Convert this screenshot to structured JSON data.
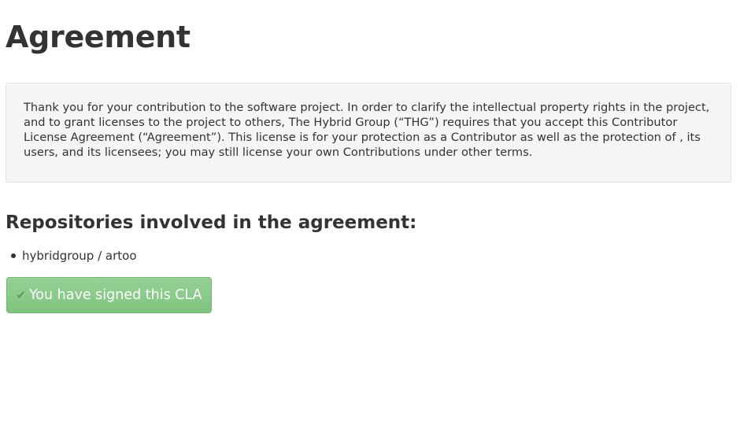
{
  "header": {
    "title": "Agreement"
  },
  "agreement": {
    "text": "Thank you for your contribution to the software project. In order to clarify the intellectual property rights in the project, and to grant licenses to the project to others, The Hybrid Group (“THG”) requires that you accept this Contributor License Agreement (“Agreement”). This license is for your protection as a Contributor as well as the protection of , its users, and its licensees; you may still license your own Contributions under other terms."
  },
  "repositories": {
    "heading": "Repositories involved in the agreement:",
    "items": [
      {
        "label": "hybridgroup / artoo"
      }
    ]
  },
  "status_button": {
    "icon": "check-icon",
    "glyph": "✔",
    "label": "You have signed this CLA",
    "color": "#8ccb8c"
  }
}
